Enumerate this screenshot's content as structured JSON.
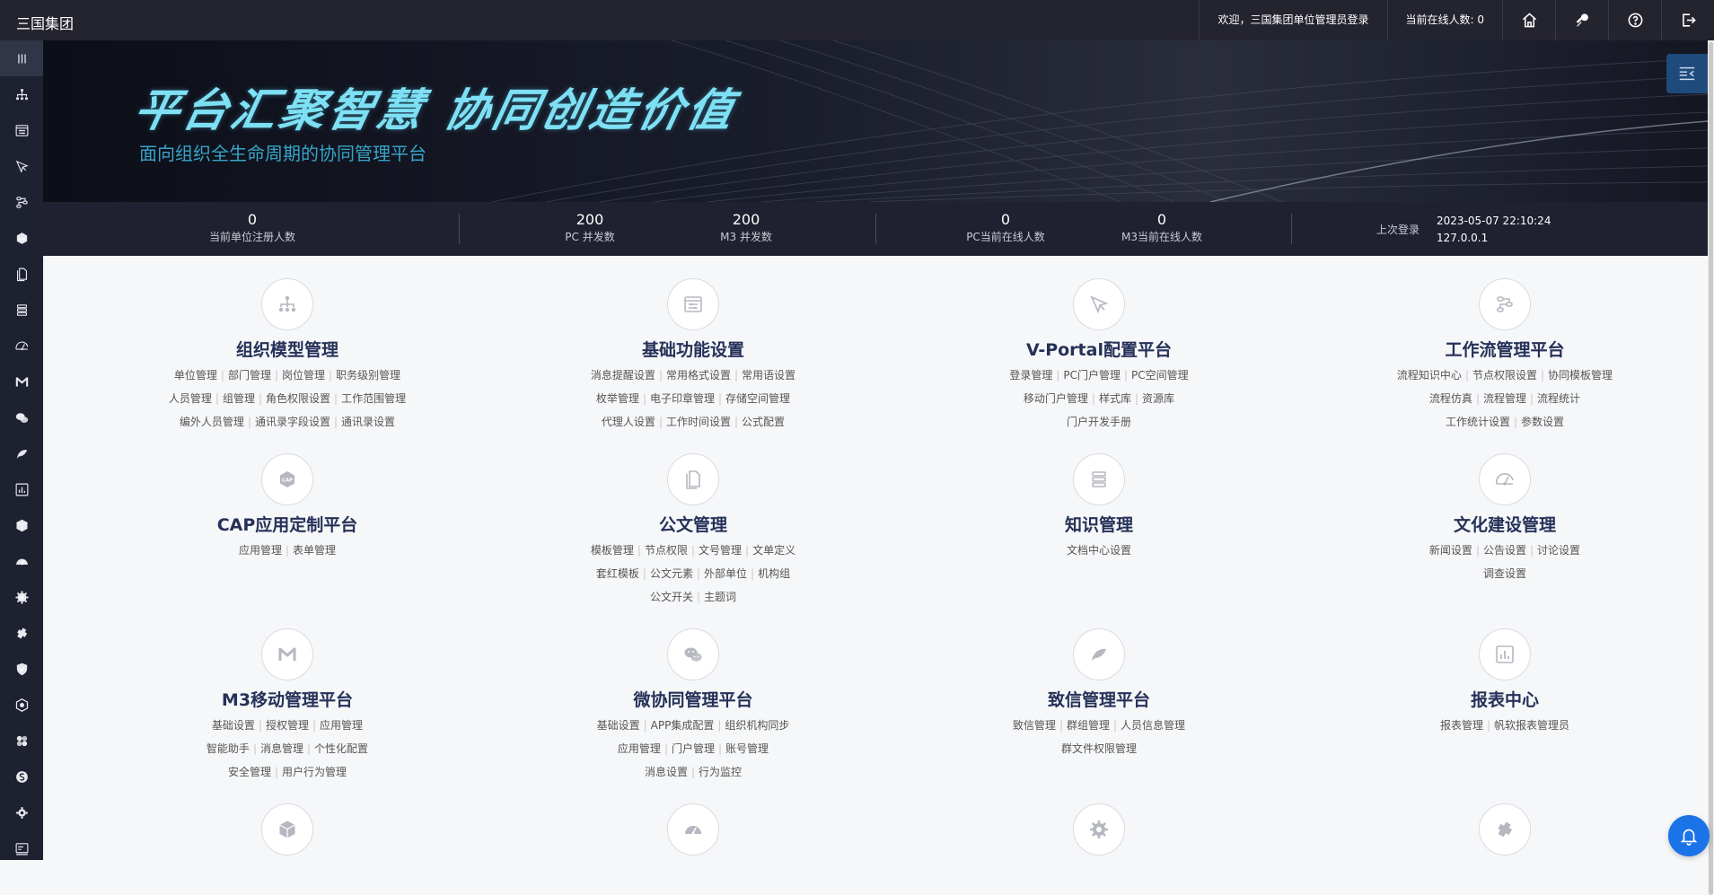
{
  "header": {
    "brand": "三国集团",
    "welcome": "欢迎，三国集团单位管理员登录",
    "online": "当前在线人数: 0",
    "icons": [
      "home-icon",
      "key-icon",
      "help-icon",
      "logout-icon"
    ]
  },
  "banner": {
    "slogan": "平台汇聚智慧  协同创造价值",
    "subtitle": "面向组织全生命周期的协同管理平台"
  },
  "stats": [
    {
      "value": "0",
      "label": "当前单位注册人数"
    },
    {
      "value": "200",
      "label": "PC 并发数"
    },
    {
      "value": "200",
      "label": "M3 并发数"
    },
    {
      "value": "0",
      "label": "PC当前在线人数"
    },
    {
      "value": "0",
      "label": "M3当前在线人数"
    }
  ],
  "last_login": {
    "label": "上次登录",
    "time": "2023-05-07 22:10:24",
    "ip": "127.0.0.1"
  },
  "sidebar": {
    "icons": [
      "menu-toggle-icon",
      "org-tree-icon",
      "settings-panel-icon",
      "portal-icon",
      "workflow-icon",
      "cap-icon",
      "document-icon",
      "knowledge-icon",
      "culture-icon",
      "m3-icon",
      "wechat-icon",
      "zhixin-icon",
      "report-icon",
      "cube-icon",
      "dashboard-icon",
      "gear-icon",
      "plugin-icon",
      "shield-icon",
      "hexagon-icon",
      "puzzle-icon",
      "coin-icon",
      "cog-icon",
      "console-icon"
    ]
  },
  "modules": [
    {
      "icon": "org-tree-icon",
      "title": "组织模型管理",
      "links": [
        [
          "单位管理",
          "部门管理",
          "岗位管理",
          "职务级别管理"
        ],
        [
          "人员管理",
          "组管理",
          "角色权限设置",
          "工作范围管理"
        ],
        [
          "编外人员管理",
          "通讯录字段设置",
          "通讯录设置"
        ]
      ]
    },
    {
      "icon": "settings-panel-icon",
      "title": "基础功能设置",
      "links": [
        [
          "消息提醒设置",
          "常用格式设置",
          "常用语设置"
        ],
        [
          "枚举管理",
          "电子印章管理",
          "存储空间管理"
        ],
        [
          "代理人设置",
          "工作时间设置",
          "公式配置"
        ]
      ]
    },
    {
      "icon": "portal-icon",
      "title": "V-Portal配置平台",
      "links": [
        [
          "登录管理",
          "PC门户管理",
          "PC空间管理"
        ],
        [
          "移动门户管理",
          "样式库",
          "资源库"
        ],
        [
          "门户开发手册"
        ]
      ]
    },
    {
      "icon": "workflow-icon",
      "title": "工作流管理平台",
      "links": [
        [
          "流程知识中心",
          "节点权限设置",
          "协同模板管理"
        ],
        [
          "流程仿真",
          "流程管理",
          "流程统计"
        ],
        [
          "工作统计设置",
          "参数设置"
        ]
      ]
    },
    {
      "icon": "cap-icon",
      "title": "CAP应用定制平台",
      "links": [
        [
          "应用管理",
          "表单管理"
        ]
      ]
    },
    {
      "icon": "document-icon",
      "title": "公文管理",
      "links": [
        [
          "模板管理",
          "节点权限",
          "文号管理",
          "文单定义"
        ],
        [
          "套红模板",
          "公文元素",
          "外部单位",
          "机构组"
        ],
        [
          "公文开关",
          "主题词"
        ]
      ]
    },
    {
      "icon": "knowledge-icon",
      "title": "知识管理",
      "links": [
        [
          "文档中心设置"
        ]
      ]
    },
    {
      "icon": "culture-icon",
      "title": "文化建设管理",
      "links": [
        [
          "新闻设置",
          "公告设置",
          "讨论设置"
        ],
        [
          "调查设置"
        ]
      ]
    },
    {
      "icon": "m3-icon",
      "title": "M3移动管理平台",
      "links": [
        [
          "基础设置",
          "授权管理",
          "应用管理"
        ],
        [
          "智能助手",
          "消息管理",
          "个性化配置"
        ],
        [
          "安全管理",
          "用户行为管理"
        ]
      ]
    },
    {
      "icon": "wechat-icon",
      "title": "微协同管理平台",
      "links": [
        [
          "基础设置",
          "APP集成配置",
          "组织机构同步"
        ],
        [
          "应用管理",
          "门户管理",
          "账号管理"
        ],
        [
          "消息设置",
          "行为监控"
        ]
      ]
    },
    {
      "icon": "zhixin-icon",
      "title": "致信管理平台",
      "links": [
        [
          "致信管理",
          "群组管理",
          "人员信息管理"
        ],
        [
          "群文件权限管理"
        ]
      ]
    },
    {
      "icon": "report-icon",
      "title": "报表中心",
      "links": [
        [
          "报表管理",
          "帆软报表管理员"
        ]
      ]
    },
    {
      "icon": "cube-icon",
      "title": "",
      "links": []
    },
    {
      "icon": "dashboard-icon",
      "title": "",
      "links": []
    },
    {
      "icon": "gear-icon",
      "title": "",
      "links": []
    },
    {
      "icon": "plugin-icon",
      "title": "",
      "links": []
    }
  ]
}
